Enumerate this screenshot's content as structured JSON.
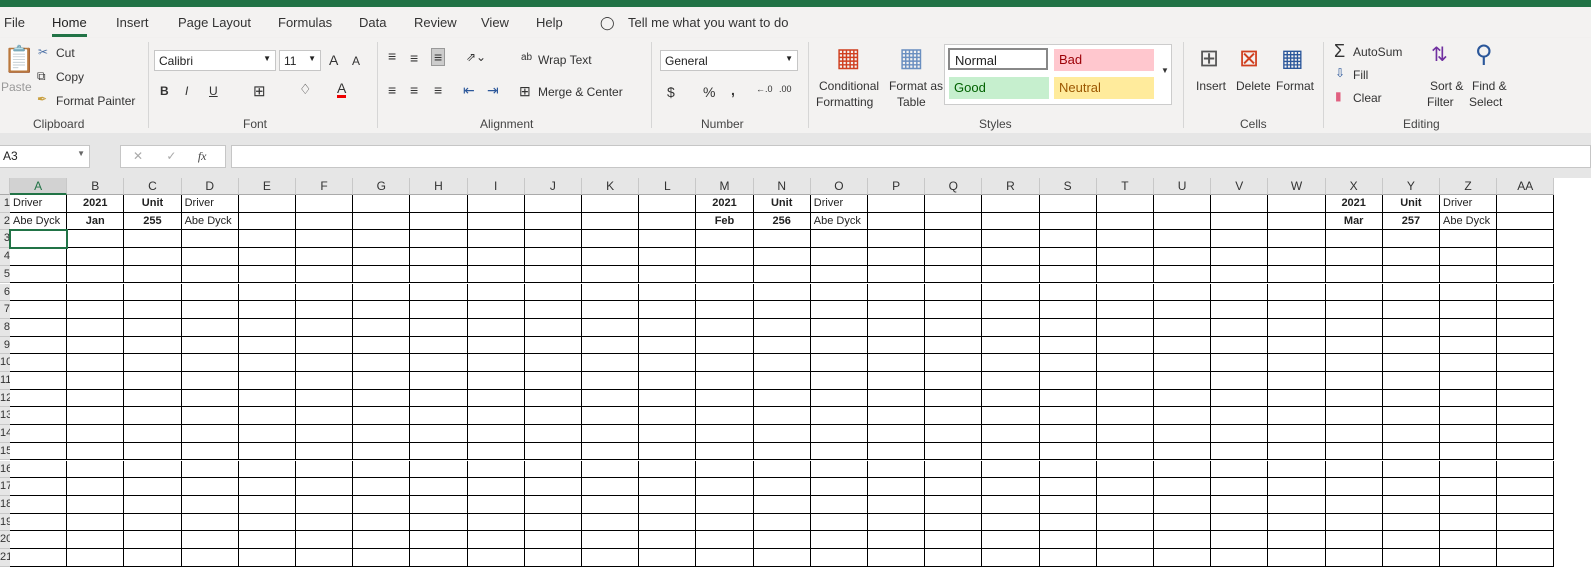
{
  "tabs": [
    "File",
    "Home",
    "Insert",
    "Page Layout",
    "Formulas",
    "Data",
    "Review",
    "View",
    "Help"
  ],
  "active_tab": "Home",
  "tell_me": "Tell me what you want to do",
  "clipboard": {
    "paste": "Paste",
    "cut": "Cut",
    "copy": "Copy",
    "format_painter": "Format Painter",
    "group": "Clipboard"
  },
  "font": {
    "name": "Calibri",
    "size": "11",
    "bold": "B",
    "italic": "I",
    "underline": "U",
    "grow": "A",
    "shrink": "A",
    "color": "A",
    "group": "Font"
  },
  "alignment": {
    "wrap": "Wrap Text",
    "merge": "Merge & Center",
    "group": "Alignment"
  },
  "number": {
    "format": "General",
    "currency": "$",
    "percent": "%",
    "comma": ",",
    "group": "Number"
  },
  "styles": {
    "conditional": [
      "Conditional",
      "Formatting"
    ],
    "format_table": [
      "Format as",
      "Table"
    ],
    "normal": "Normal",
    "bad": "Bad",
    "good": "Good",
    "neutral": "Neutral",
    "group": "Styles"
  },
  "cells_group": {
    "insert": "Insert",
    "delete": "Delete",
    "format": "Format",
    "group": "Cells"
  },
  "editing": {
    "autosum": "AutoSum",
    "fill": "Fill",
    "clear": "Clear",
    "sort": [
      "Sort &",
      "Filter"
    ],
    "find": [
      "Find &",
      "Select"
    ],
    "group": "Editing"
  },
  "name_box": "A3",
  "formula": "",
  "fx": "fx",
  "columns": [
    "A",
    "B",
    "C",
    "D",
    "E",
    "F",
    "G",
    "H",
    "I",
    "J",
    "K",
    "L",
    "M",
    "N",
    "O",
    "P",
    "Q",
    "R",
    "S",
    "T",
    "U",
    "V",
    "W",
    "X",
    "Y",
    "Z",
    "AA"
  ],
  "rows": [
    "1",
    "2",
    "3",
    "4",
    "5",
    "6",
    "7",
    "8",
    "9",
    "10",
    "11",
    "12",
    "13",
    "14",
    "15",
    "16",
    "17",
    "18",
    "19",
    "20",
    "21"
  ],
  "cells": [
    {
      "ref": "A1",
      "v": "Driver",
      "bold": false
    },
    {
      "ref": "B1",
      "v": "2021",
      "bold": true
    },
    {
      "ref": "C1",
      "v": "Unit",
      "bold": true
    },
    {
      "ref": "D1",
      "v": "Driver",
      "bold": false
    },
    {
      "ref": "A2",
      "v": "Abe Dyck",
      "bold": false
    },
    {
      "ref": "B2",
      "v": "Jan",
      "bold": true
    },
    {
      "ref": "C2",
      "v": "255",
      "bold": true
    },
    {
      "ref": "D2",
      "v": "Abe Dyck",
      "bold": false
    },
    {
      "ref": "M1",
      "v": "2021",
      "bold": true
    },
    {
      "ref": "N1",
      "v": "Unit",
      "bold": true
    },
    {
      "ref": "O1",
      "v": "Driver",
      "bold": false
    },
    {
      "ref": "M2",
      "v": "Feb",
      "bold": true
    },
    {
      "ref": "N2",
      "v": "256",
      "bold": true
    },
    {
      "ref": "O2",
      "v": "Abe Dyck",
      "bold": false
    },
    {
      "ref": "X1",
      "v": "2021",
      "bold": true
    },
    {
      "ref": "Y1",
      "v": "Unit",
      "bold": true
    },
    {
      "ref": "Z1",
      "v": "Driver",
      "bold": false
    },
    {
      "ref": "X2",
      "v": "Mar",
      "bold": true
    },
    {
      "ref": "Y2",
      "v": "257",
      "bold": true
    },
    {
      "ref": "Z2",
      "v": "Abe Dyck",
      "bold": false
    }
  ],
  "selected": "A3",
  "colors": {
    "accent": "#217346",
    "bad_bg": "#ffc7ce",
    "bad_fg": "#9c0006",
    "good_bg": "#c6efce",
    "good_fg": "#006100",
    "neutral_bg": "#ffeb9c",
    "neutral_fg": "#9c5700"
  }
}
